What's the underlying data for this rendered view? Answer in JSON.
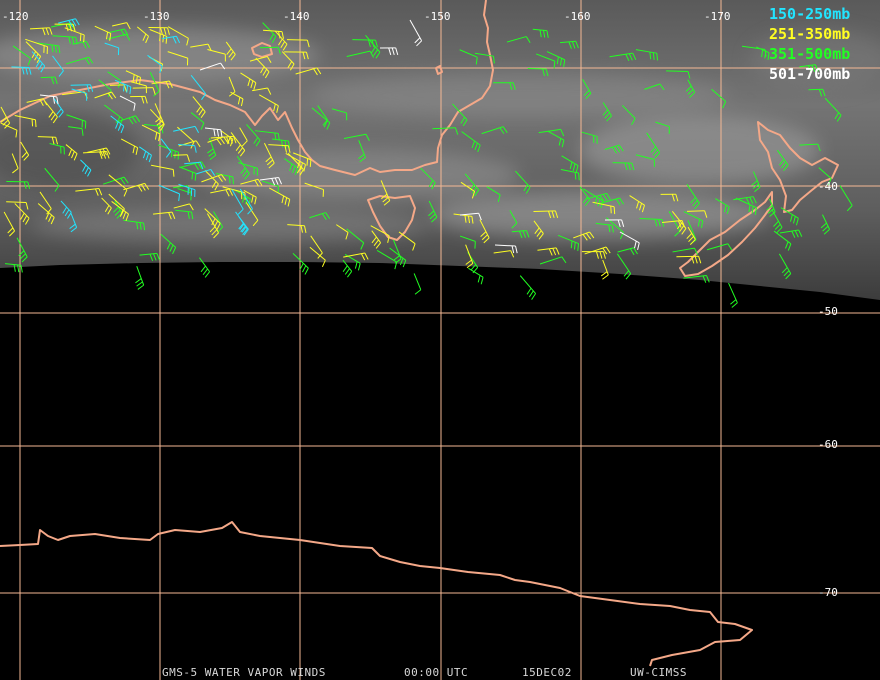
{
  "map": {
    "longitude_labels": [
      "-120",
      "-130",
      "-140",
      "-150",
      "-160",
      "-170"
    ],
    "latitude_labels": [
      "-40",
      "-50",
      "-60",
      "-70"
    ],
    "gridline_color": "#f4b894",
    "coastline_color": "#f4a888"
  },
  "legend": [
    {
      "label": "150-250mb",
      "color": "#22e5ff"
    },
    {
      "label": "251-350mb",
      "color": "#ffff22"
    },
    {
      "label": "351-500mb",
      "color": "#22ff22"
    },
    {
      "label": "501-700mb",
      "color": "#ffffff"
    }
  ],
  "footer": {
    "product": "GMS-5 WATER VAPOR WINDS",
    "time": "00:00 UTC",
    "date": "15DEC02",
    "source": "UW-CIMSS"
  }
}
